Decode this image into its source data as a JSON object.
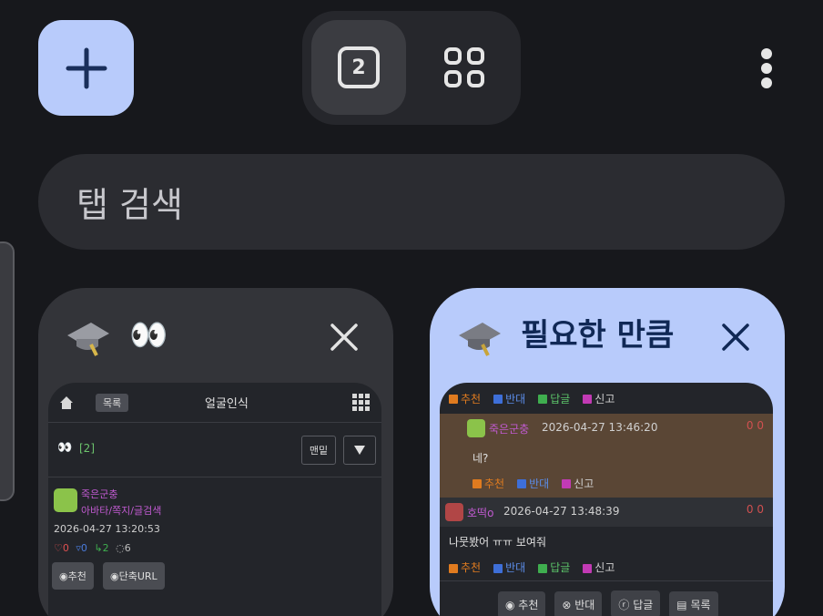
{
  "toolbar": {
    "tab_count": "2"
  },
  "search": {
    "placeholder": "탭 검색"
  },
  "tabs": [
    {
      "title": "👀",
      "thumbnail": {
        "list_label": "목록",
        "board_title": "얼굴인식",
        "post_title": "👀",
        "comment_count": "[2]",
        "view_button": "맨밑",
        "author": "죽은군충",
        "author_links": "아바타/쪽지/글검색",
        "timestamp": "2026-04-27 13:20:53",
        "stats": [
          "0",
          "0",
          "2",
          "6"
        ],
        "buttons": [
          "추천",
          "단축URL"
        ]
      }
    },
    {
      "title": "필요한 만큼",
      "thumbnail": {
        "actions": [
          "추천",
          "반대",
          "답글",
          "신고"
        ],
        "comment1": {
          "author": "죽은군충",
          "time": "2026-04-27 13:46:20",
          "score": "0 0",
          "text": "네?"
        },
        "comment2": {
          "author": "호떡o",
          "time": "2026-04-27 13:48:39",
          "score": "0 0",
          "text": "나뭇봤어 ㅠㅠ 보여줘"
        },
        "buttons": [
          "추천",
          "반대",
          "답글",
          "목록"
        ]
      }
    }
  ],
  "colors": {
    "accent": "#b8cbfb",
    "background": "#17181c",
    "card_inactive": "#333439"
  }
}
